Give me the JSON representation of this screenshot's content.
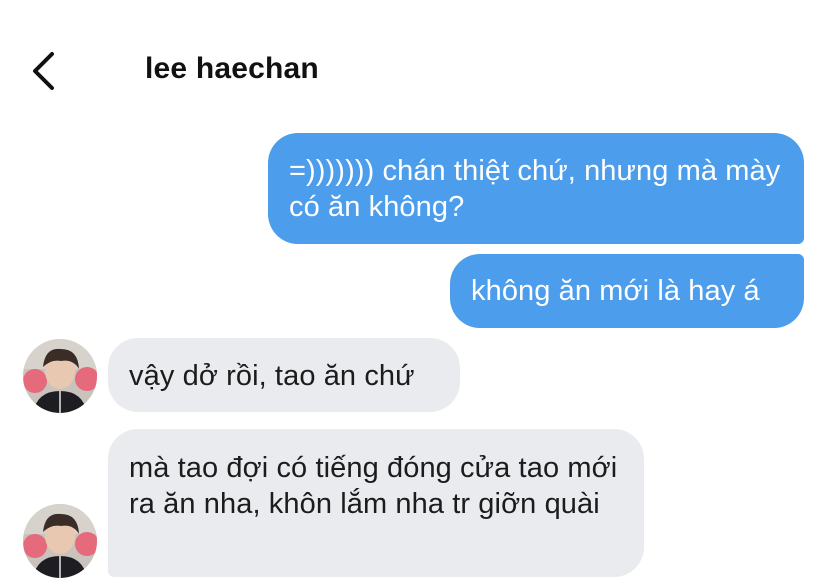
{
  "header": {
    "title": "lee haechan",
    "back_icon": "chevron-left-icon"
  },
  "messages": [
    {
      "direction": "outgoing",
      "text": "=))))))) chán thiệt chứ, nhưng mà mày có ăn không?"
    },
    {
      "direction": "outgoing",
      "text": "không ăn mới là hay á"
    },
    {
      "direction": "incoming",
      "text": "vậy dở rồi, tao ăn chứ"
    },
    {
      "direction": "incoming",
      "text": "mà tao đợi có tiếng đóng cửa tao mới ra ăn nha, khôn lắm nha tr giỡn quài"
    }
  ],
  "colors": {
    "outgoing_bubble": "#4c9deb",
    "incoming_bubble": "#e9ebef",
    "background": "#ffffff"
  }
}
